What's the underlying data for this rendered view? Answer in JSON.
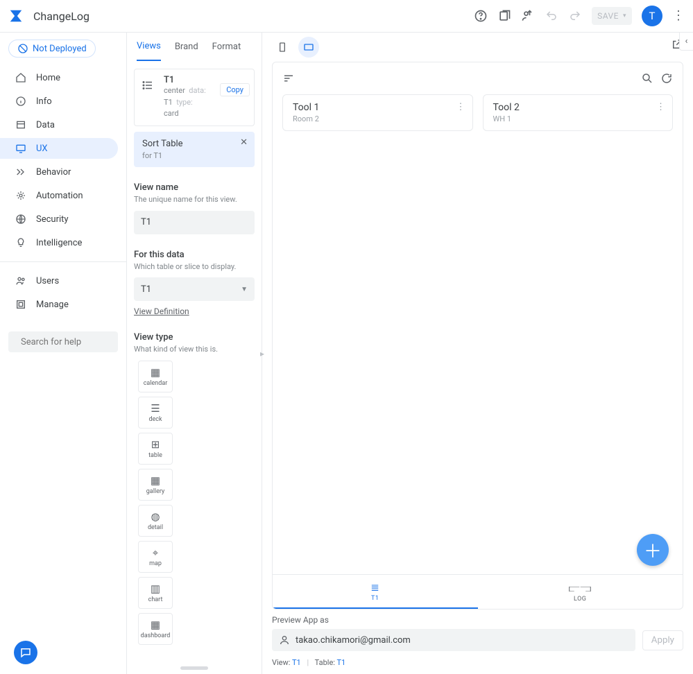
{
  "header": {
    "app_title": "ChangeLog",
    "save_label": "SAVE",
    "avatar_initial": "T"
  },
  "leftnav": {
    "deploy_status": "Not Deployed",
    "items_main": [
      {
        "label": "Home"
      },
      {
        "label": "Info"
      },
      {
        "label": "Data"
      },
      {
        "label": "UX"
      },
      {
        "label": "Behavior"
      },
      {
        "label": "Automation"
      },
      {
        "label": "Security"
      },
      {
        "label": "Intelligence"
      }
    ],
    "items_lower": [
      {
        "label": "Users"
      },
      {
        "label": "Manage"
      }
    ],
    "search_placeholder": "Search for help"
  },
  "mid": {
    "tabs": [
      "Views",
      "Brand",
      "Format"
    ],
    "view_card": {
      "title": "T1",
      "line1_val": "center",
      "line1_key": "data:",
      "line2_val": "T1",
      "line2_key": "type:",
      "line3_val": "card",
      "copy": "Copy"
    },
    "sort_card": {
      "title": "Sort Table",
      "sub": "for T1"
    },
    "view_name": {
      "label": "View name",
      "desc": "The unique name for this view.",
      "value": "T1"
    },
    "for_data": {
      "label": "For this data",
      "desc": "Which table or slice to display.",
      "value": "T1",
      "link": "View Definition"
    },
    "view_type": {
      "label": "View type",
      "desc": "What kind of view this is.",
      "options": [
        {
          "id": "calendar",
          "label": "calendar"
        },
        {
          "id": "deck",
          "label": "deck"
        },
        {
          "id": "table",
          "label": "table"
        },
        {
          "id": "gallery",
          "label": "gallery"
        },
        {
          "id": "detail",
          "label": "detail"
        },
        {
          "id": "map",
          "label": "map"
        },
        {
          "id": "chart",
          "label": "chart"
        },
        {
          "id": "dashboard",
          "label": "dashboard"
        }
      ]
    }
  },
  "preview": {
    "cards": [
      {
        "title": "Tool 1",
        "sub": "Room 2"
      },
      {
        "title": "Tool 2",
        "sub": "WH 1"
      }
    ],
    "bottom_tabs": [
      {
        "id": "T1",
        "label": "T1"
      },
      {
        "id": "LOG",
        "label": "LOG"
      }
    ],
    "footer": {
      "label": "Preview App as",
      "email": "takao.chikamori@gmail.com",
      "apply": "Apply",
      "view_key": "View:",
      "view_val": "T1",
      "table_key": "Table:",
      "table_val": "T1"
    }
  }
}
